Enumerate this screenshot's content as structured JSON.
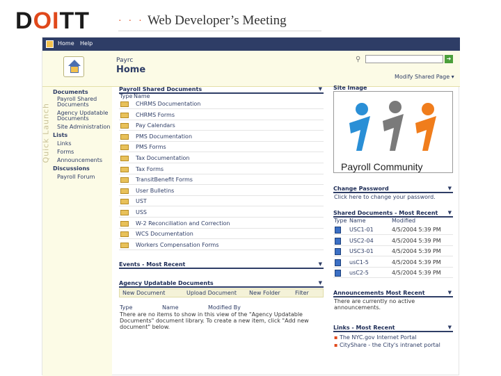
{
  "header": {
    "logo_left": "D",
    "logo_mid": "OI",
    "logo_right": "TT",
    "dots": "· · ·",
    "meeting_title": "Web Developer’s Meeting"
  },
  "topnav": {
    "home": "Home",
    "help": "Help"
  },
  "site": {
    "small_title": "Payrc",
    "title": "Home",
    "modify": "Modify Shared Page ▾",
    "search_placeholder": ""
  },
  "quick_launch": {
    "label": "Quick Launch",
    "items": [
      {
        "label": "Documents",
        "heading": true
      },
      {
        "label": "Payroll Shared",
        "heading": false
      },
      {
        "label": "Documents",
        "heading": false
      },
      {
        "label": "Agency Updatable",
        "heading": false
      },
      {
        "label": "Documents",
        "heading": false
      },
      {
        "label": "Site Administration",
        "heading": false
      },
      {
        "label": "Lists",
        "heading": true
      },
      {
        "label": "Links",
        "heading": false
      },
      {
        "label": "Forms",
        "heading": false
      },
      {
        "label": "Announcements",
        "heading": false
      },
      {
        "label": "Discussions",
        "heading": true
      },
      {
        "label": "Payroll Forum",
        "heading": false
      }
    ]
  },
  "shared_docs": {
    "title": "Payroll Shared Documents",
    "col_type": "Type",
    "col_name": "Name",
    "items": [
      "CHRMS Documentation",
      "CHRMS Forms",
      "Pay Calendars",
      "PMS Documentation",
      "PMS Forms",
      "Tax Documentation",
      "Tax Forms",
      "TransitBenefit Forms",
      "User Bulletins",
      "UST",
      "USS",
      "W-2 Reconciliation and Correction",
      "WCS Documentation",
      "Workers Compensation Forms"
    ]
  },
  "events": {
    "title": "Events - Most Recent"
  },
  "agency_docs": {
    "title": "Agency Updatable Documents",
    "toolbar": {
      "new": "New Document",
      "upload": "Upload Document",
      "folder": "New Folder",
      "filter": "Filter"
    },
    "col_type": "Type",
    "col_name": "Name",
    "col_modified": "Modified By",
    "empty_text": "There are no items to show in this view of the \"Agency Updatable Documents\" document library. To create a new item, click \"Add new document\" below."
  },
  "site_image": {
    "title": "Site Image",
    "caption": "Payroll Community"
  },
  "change_password": {
    "title": "Change Password",
    "text": "Click here to change your password."
  },
  "shared_recent": {
    "title": "Shared Documents - Most Recent",
    "col_type": "Type",
    "col_name": "Name",
    "col_modified": "Modified",
    "rows": [
      {
        "name": "USC1-01",
        "modified": "4/5/2004 5:39 PM"
      },
      {
        "name": "USC2-04",
        "modified": "4/5/2004 5:39 PM"
      },
      {
        "name": "USC3-01",
        "modified": "4/5/2004 5:39 PM"
      },
      {
        "name": "usC1-5",
        "modified": "4/5/2004 5:39 PM"
      },
      {
        "name": "usC2-5",
        "modified": "4/5/2004 5:39 PM"
      }
    ]
  },
  "announcements": {
    "title": "Announcements Most Recent",
    "text": "There are currently no active announcements."
  },
  "links": {
    "title": "Links - Most Recent",
    "items": [
      "The NYC.gov Internet Portal",
      "CityShare - the City's intranet portal"
    ]
  },
  "colors": {
    "nav": "#2e3d66",
    "accent": "#e0481b",
    "panel": "#fcfbe6"
  }
}
